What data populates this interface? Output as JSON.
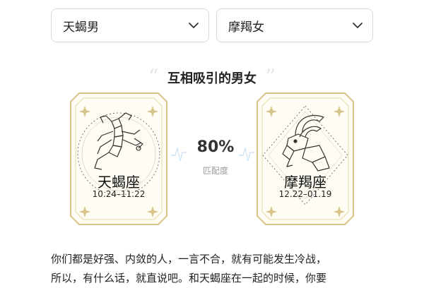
{
  "selects": {
    "left": {
      "value": "天蝎男"
    },
    "right": {
      "value": "摩羯女"
    }
  },
  "heading": {
    "title": "互相吸引的男女",
    "quote_open": "“",
    "quote_close": "”"
  },
  "cards": {
    "left": {
      "name": "天蝎座",
      "range": "10.24–11.22"
    },
    "right": {
      "name": "摩羯座",
      "range": "12.22–01.19"
    }
  },
  "match": {
    "percent": "80%",
    "label": "匹配度"
  },
  "paragraph": {
    "line1": "你们都是好强、内敛的人，一言不合，就有可能发生冷战，",
    "line2": "所以，有什么话，就直说吧。和天蝎座在一起的时候，你要"
  },
  "colors": {
    "gold": "#d8c48a",
    "card_bg": "#fffdf3",
    "pulse": "#cfe3f3"
  }
}
